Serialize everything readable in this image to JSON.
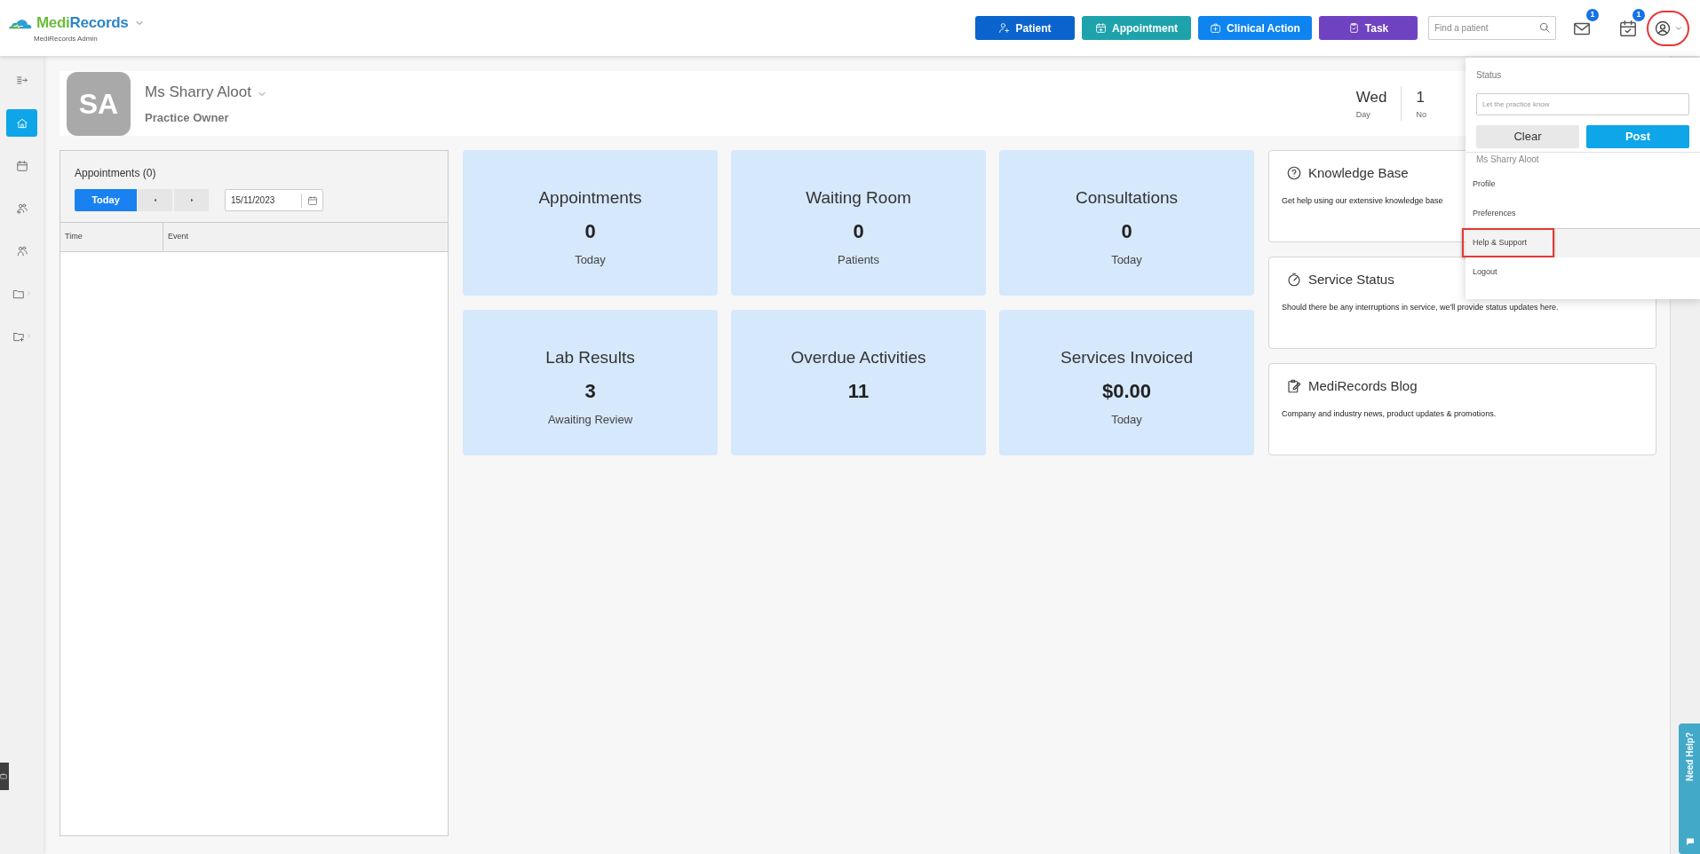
{
  "app": {
    "brand_parts": [
      "Medi",
      "Records"
    ],
    "subtitle": "MediRecords Admin"
  },
  "toolbar": {
    "actions": [
      {
        "kind": "patient",
        "label": "Patient",
        "color": "#0b63ce"
      },
      {
        "kind": "appointment",
        "label": "Appointment",
        "color": "#1ea3ad"
      },
      {
        "kind": "clinical",
        "label": "Clinical Action",
        "color": "#0d84f0"
      },
      {
        "kind": "task",
        "label": "Task",
        "color": "#6f42c1"
      }
    ],
    "search": {
      "placeholder": "Find a patient"
    },
    "notifications": [
      {
        "kind": "mail",
        "count": "1"
      },
      {
        "kind": "tasks",
        "count": "1"
      }
    ],
    "account_button": {
      "annotated": true
    }
  },
  "sidebar": {
    "items": [
      {
        "kind": "collapse",
        "selected": false,
        "has_submenu": false
      },
      {
        "kind": "home",
        "selected": true,
        "has_submenu": false
      },
      {
        "kind": "calendar",
        "selected": false,
        "has_submenu": false
      },
      {
        "kind": "patients",
        "selected": false,
        "has_submenu": false
      },
      {
        "kind": "contacts",
        "selected": false,
        "has_submenu": false
      },
      {
        "kind": "folder",
        "selected": false,
        "has_submenu": true
      },
      {
        "kind": "folder-export",
        "selected": false,
        "has_submenu": true
      }
    ]
  },
  "profile": {
    "initials": "SA",
    "name": "Ms Sharry Aloot",
    "role": "Practice Owner",
    "date": [
      {
        "value": "Wed",
        "label": "Day"
      },
      {
        "value": "1",
        "label": "No"
      }
    ]
  },
  "appointments": {
    "title": "Appointments (0)",
    "today_button": "Today",
    "date": "15/11/2023",
    "columns": [
      "Time",
      "Event"
    ]
  },
  "tiles": [
    {
      "title": "Appointments",
      "value": "0",
      "caption": "Today"
    },
    {
      "title": "Waiting Room",
      "value": "0",
      "caption": "Patients"
    },
    {
      "title": "Consultations",
      "value": "0",
      "caption": "Today"
    },
    {
      "title": "Lab Results",
      "value": "3",
      "caption": "Awaiting Review"
    },
    {
      "title": "Overdue Activities",
      "value": "11"
    },
    {
      "title": "Services Invoiced",
      "value": "$0.00",
      "caption": "Today"
    }
  ],
  "cards": [
    {
      "kind": "help",
      "title": "Knowledge Base",
      "text": "Get help using our extensive knowledge base"
    },
    {
      "kind": "gauge",
      "title": "Service Status",
      "text": "Should there be any interruptions in service, we'll provide status updates here."
    },
    {
      "kind": "blog",
      "title": "MediRecords Blog",
      "text": "Company and industry news, product updates & promotions."
    }
  ],
  "account_menu": {
    "status_label": "Status",
    "status_placeholder": "Let the practice know",
    "buttons": [
      {
        "kind": "secondary",
        "label": "Clear"
      },
      {
        "kind": "primary",
        "label": "Post"
      }
    ],
    "user": "Ms Sharry Aloot",
    "items": [
      {
        "label": "Profile",
        "highlighted": false,
        "annotated": false,
        "divider_before": false
      },
      {
        "label": "Preferences",
        "highlighted": false,
        "annotated": false,
        "divider_before": false
      },
      {
        "label": "Help & Support",
        "highlighted": true,
        "annotated": true,
        "divider_before": true
      },
      {
        "label": "Logout",
        "highlighted": false,
        "annotated": false,
        "divider_before": false
      }
    ]
  },
  "help_tab": {
    "label": "Need Help?"
  }
}
